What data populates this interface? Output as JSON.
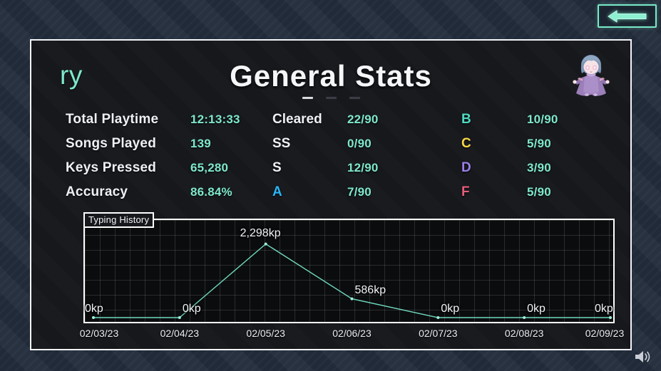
{
  "window": {
    "title": "General Stats"
  },
  "topbar": {
    "back_button": {
      "label": "Back",
      "icon": "arrow-left-icon",
      "color": "#79e8c8"
    }
  },
  "panel": {
    "username": "ry",
    "title": "General Stats",
    "page_dots": [
      {
        "active": true
      },
      {
        "active": false
      },
      {
        "active": false
      }
    ],
    "avatar": {
      "name": "player-avatar",
      "hair_color": "#8fa8c4",
      "dress_color": "#9a7fb8",
      "eye_color": "#f2b5d4"
    }
  },
  "stats": {
    "rows": [
      {
        "label": "Total Playtime",
        "value": "12:13:33",
        "grade_a": "Cleared",
        "grade_a_value": "22/90",
        "grade_a_color": "#eef1f4",
        "grade_b": "B",
        "grade_b_value": "10/90",
        "grade_b_color": "#4dd9c0"
      },
      {
        "label": "Songs Played",
        "value": "139",
        "grade_a": "SS",
        "grade_a_value": "0/90",
        "grade_a_color": "#eef1f4",
        "grade_b": "C",
        "grade_b_value": "5/90",
        "grade_b_color": "#f5d547"
      },
      {
        "label": "Keys Pressed",
        "value": "65,280",
        "grade_a": "S",
        "grade_a_value": "12/90",
        "grade_a_color": "#eef1f4",
        "grade_b": "D",
        "grade_b_value": "3/90",
        "grade_b_color": "#9b7fe8"
      },
      {
        "label": "Accuracy",
        "value": "86.84%",
        "grade_a": "A",
        "grade_a_value": "7/90",
        "grade_a_color": "#29b6f6",
        "grade_b": "F",
        "grade_b_value": "5/90",
        "grade_b_color": "#e85c7a"
      }
    ],
    "value_color": "#7fe8cc"
  },
  "chart_data": {
    "type": "line",
    "title": "Typing History",
    "xlabel": "",
    "ylabel": "",
    "unit": "kp",
    "line_color": "#6fd9bd",
    "grid": true,
    "legend": "none",
    "categories": [
      "02/03/23",
      "02/04/23",
      "02/05/23",
      "02/06/23",
      "02/07/23",
      "02/08/23",
      "02/09/23"
    ],
    "values": [
      0,
      0,
      2298,
      586,
      0,
      0,
      0
    ],
    "point_labels": [
      "0kp",
      "0kp",
      "2,298kp",
      "586kp",
      "0kp",
      "0kp",
      "0kp"
    ],
    "ylim": [
      0,
      2600
    ],
    "xlim": [
      "02/03/23",
      "02/09/23"
    ]
  },
  "footer": {
    "volume_icon": "speaker-volume-icon"
  }
}
